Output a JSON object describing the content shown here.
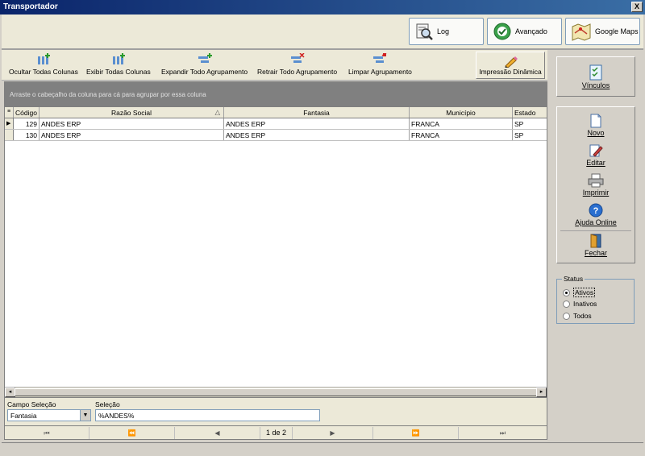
{
  "window": {
    "title": "Transportador",
    "close_label": "X"
  },
  "top_buttons": {
    "log": "Log",
    "advanced": "Avançado",
    "maps": "Google Maps"
  },
  "toolbar": {
    "hide_cols": "Ocultar Todas Colunas",
    "show_cols": "Exibir Todas  Colunas",
    "expand": "Expandir Todo Agrupamento",
    "collapse": "Retrair Todo Agrupamento",
    "clear": "Limpar Agrupamento",
    "dynamic_print": "Impressão Dinâmica"
  },
  "grid": {
    "group_hint": "Arraste o cabeçalho da coluna para cá para agrupar por essa coluna",
    "columns": [
      "Código",
      "Razão Social",
      "Fantasia",
      "Município",
      "Estado"
    ],
    "rows": [
      [
        "129",
        "ANDES ERP",
        "ANDES ERP",
        "FRANCA",
        "SP"
      ],
      [
        "130",
        "ANDES ERP",
        "ANDES ERP",
        "FRANCA",
        "SP"
      ]
    ],
    "sort_indicator": "△",
    "current_row_marker": "▶"
  },
  "selection": {
    "field_label": "Campo Seleção",
    "field_value": "Fantasia",
    "value_label": "Seleção",
    "value": "%ANDES%"
  },
  "navigator": {
    "first": "⏮",
    "prev_page": "⏪",
    "prev": "◀",
    "page": "1 de 2",
    "next": "▶",
    "next_page": "⏩",
    "last": "⏭"
  },
  "side": {
    "links": "Vínculos",
    "new": "Novo",
    "edit": "Editar",
    "print": "Imprimir",
    "help": "Ajuda Online",
    "close": "Fechar"
  },
  "status": {
    "legend": "Status",
    "options": [
      "Ativos",
      "Inativos",
      "Todos"
    ],
    "selected": "Ativos"
  },
  "colors": {
    "title_start": "#0a246a",
    "title_end": "#3a6ea5",
    "group_panel": "#808080"
  }
}
